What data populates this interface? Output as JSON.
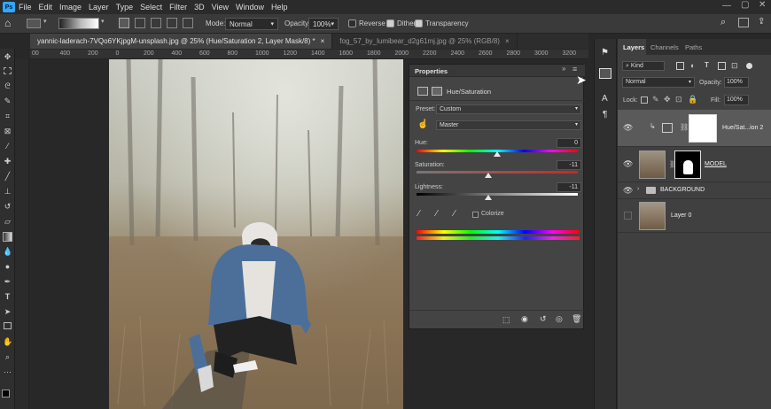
{
  "menubar": {
    "logo": "Ps",
    "items": [
      "File",
      "Edit",
      "Image",
      "Layer",
      "Type",
      "Select",
      "Filter",
      "3D",
      "View",
      "Window",
      "Help"
    ]
  },
  "options": {
    "mode_label": "Mode:",
    "mode_value": "Normal",
    "opacity_label": "Opacity:",
    "opacity_value": "100%",
    "reverse_label": "Reverse",
    "dither_label": "Dither",
    "transparency_label": "Transparency"
  },
  "tabs": [
    {
      "label": "yannic-laderach-7VQo6YKjpgM-unsplash.jpg @ 25% (Hue/Saturation 2, Layer Mask/8) *",
      "close": "×"
    },
    {
      "label": "fog_57_by_lumibear_d2g61mj.jpg @ 25% (RGB/8)",
      "close": "×"
    }
  ],
  "ruler": {
    "ticks": [
      "00",
      "400",
      "200",
      "0",
      "200",
      "400",
      "600",
      "800",
      "1000",
      "1200",
      "1400",
      "1600",
      "1800",
      "2000",
      "2200",
      "2400",
      "2600",
      "2800",
      "3000",
      "3200"
    ]
  },
  "properties": {
    "title": "Properties",
    "adjustment_name": "Hue/Saturation",
    "preset_label": "Preset:",
    "preset_value": "Custom",
    "channel_value": "Master",
    "hue_label": "Hue:",
    "hue_value": "0",
    "saturation_label": "Saturation:",
    "saturation_value": "-11",
    "lightness_label": "Lightness:",
    "lightness_value": "-11",
    "colorize_label": "Colorize"
  },
  "layers_panel": {
    "tabs": [
      "Layers",
      "Channels",
      "Paths"
    ],
    "kind_value": "Kind",
    "blend_value": "Normal",
    "opacity_label": "Opacity:",
    "opacity_value": "100%",
    "lock_label": "Lock:",
    "fill_label": "Fill:",
    "fill_value": "100%",
    "layers": [
      {
        "name": "Hue/Sat...ion 2"
      },
      {
        "name": "MODEL"
      },
      {
        "name": "BACKGROUND"
      },
      {
        "name": "Layer 0"
      }
    ]
  },
  "colors": {
    "accent": "#31a8ff",
    "panel_bg": "#444444",
    "app_bg": "#282828"
  }
}
